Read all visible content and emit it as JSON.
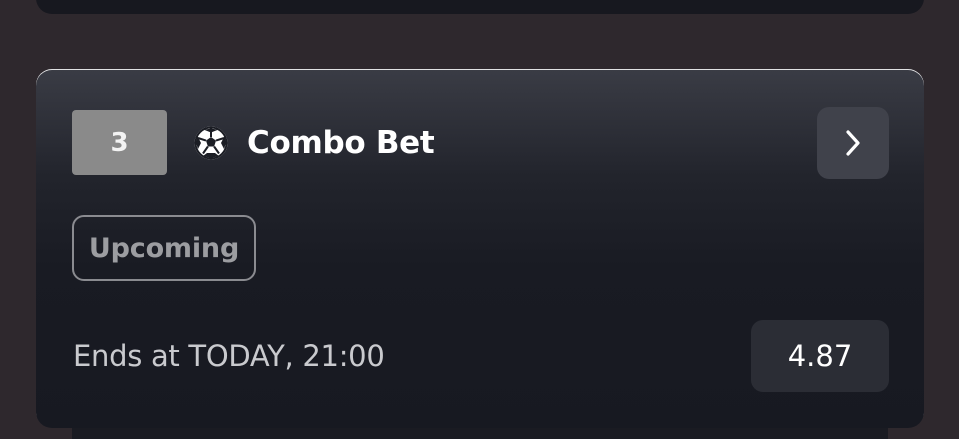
{
  "bet": {
    "count": "3",
    "sport_icon": "soccer-ball-icon",
    "title": "Combo Bet",
    "status": "Upcoming",
    "ends_label": "Ends at TODAY, 21:00",
    "odds": "4.87",
    "nav_icon": "chevron-right-icon"
  },
  "colors": {
    "page_bg": "#2e282d",
    "card_bg": "#171921",
    "badge_bg": "#8a8a8a",
    "button_bg": "#40424b",
    "odds_bg": "#2b2d35"
  }
}
